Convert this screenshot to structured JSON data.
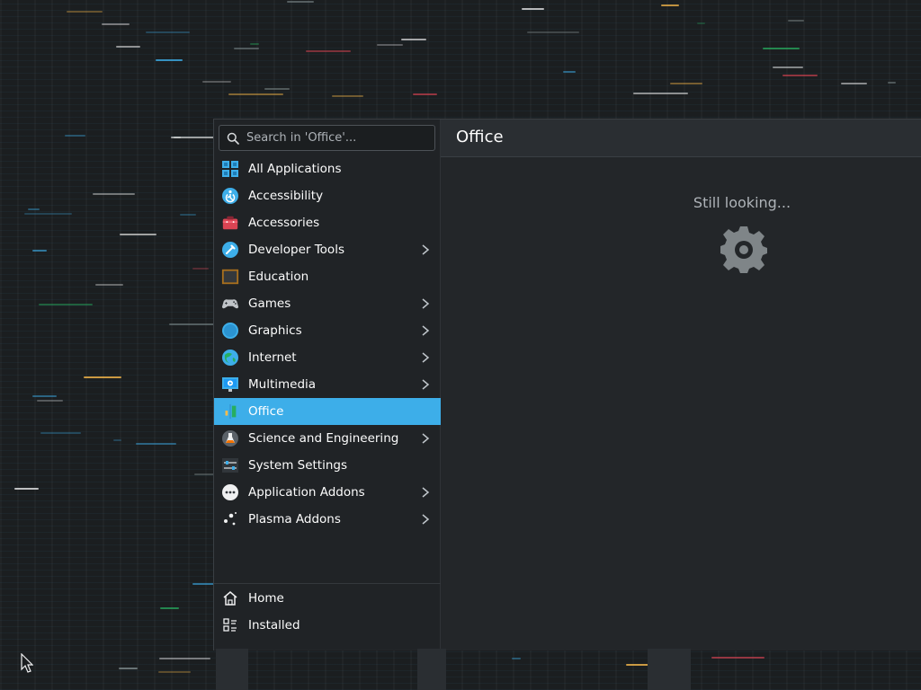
{
  "search": {
    "placeholder": "Search in 'Office'..."
  },
  "categories": [
    {
      "label": "All Applications",
      "icon": "grid-icon",
      "has_submenu": false
    },
    {
      "label": "Accessibility",
      "icon": "accessibility-icon",
      "has_submenu": false
    },
    {
      "label": "Accessories",
      "icon": "toolbox-icon",
      "has_submenu": false
    },
    {
      "label": "Developer Tools",
      "icon": "developer-tools-icon",
      "has_submenu": true
    },
    {
      "label": "Education",
      "icon": "chalkboard-icon",
      "has_submenu": false
    },
    {
      "label": "Games",
      "icon": "gamepad-icon",
      "has_submenu": true
    },
    {
      "label": "Graphics",
      "icon": "graphics-icon",
      "has_submenu": true
    },
    {
      "label": "Internet",
      "icon": "globe-icon",
      "has_submenu": true
    },
    {
      "label": "Multimedia",
      "icon": "multimedia-icon",
      "has_submenu": true
    },
    {
      "label": "Office",
      "icon": "office-icon",
      "has_submenu": false,
      "selected": true
    },
    {
      "label": "Science and Engineering",
      "icon": "science-icon",
      "has_submenu": true
    },
    {
      "label": "System Settings",
      "icon": "settings-icon",
      "has_submenu": false
    },
    {
      "label": "Application Addons",
      "icon": "addons-icon",
      "has_submenu": true
    },
    {
      "label": "Plasma Addons",
      "icon": "plasma-icon",
      "has_submenu": true
    }
  ],
  "bottom_nav": [
    {
      "label": "Home",
      "icon": "home-icon"
    },
    {
      "label": "Installed",
      "icon": "installed-list-icon"
    }
  ],
  "content": {
    "title": "Office",
    "status": "Still looking..."
  },
  "colors": {
    "accent": "#3daee9",
    "window_bg": "#232629",
    "sidebar_bg": "#202326"
  }
}
